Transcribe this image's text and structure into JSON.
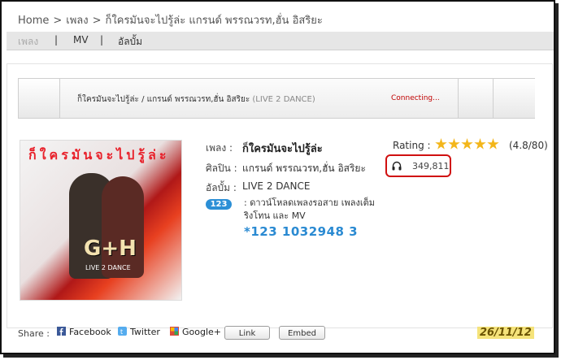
{
  "breadcrumb": {
    "home": "Home",
    "sep1": ">",
    "section": "เพลง",
    "sep2": ">",
    "current": "ก็ใครมันจะไปรู้ล่ะ แกรนด์ พรรณวรท,ฮั่น อิสริยะ"
  },
  "tabs": {
    "songs": "เพลง",
    "sep1": "|",
    "mv": "MV",
    "sep2": "|",
    "albums": "อัลบั้ม"
  },
  "player": {
    "track_title": "ก็ใครมันจะไปรู้ล่ะ",
    "track_sep": " / ",
    "track_artist": "แกรนด์ พรรณวรท,ฮั่น อิสริยะ",
    "track_album": " (LIVE 2 DANCE)",
    "status": "Connecting..."
  },
  "cover": {
    "title_art": "ก็ใครมันจะไปรู้ล่ะ",
    "album_art": "G+H",
    "album_sub": "LIVE 2 DANCE"
  },
  "info": {
    "song_label": "เพลง :",
    "song_value": "ก็ใครมันจะไปรู้ล่ะ",
    "artist_label": "ศิลปิน :",
    "artist_value": "แกรนด์ พรรณวรท,ฮั่น อิสริยะ",
    "album_label": "อัลบั้ม :",
    "album_value": "LIVE 2 DANCE",
    "badge": "123",
    "promo_text": ": ดาวน์โหลดเพลงรอสาย เพลงเต็ม ริงโทน และ MV",
    "code": "*123 1032948 3"
  },
  "rating": {
    "label": "Rating :",
    "stars": 5,
    "value": "(4.8/80)"
  },
  "plays": {
    "icon": "headphones-icon",
    "count": "349,811",
    "highlight_color": "#d01010"
  },
  "share": {
    "label": "Share :",
    "facebook": "Facebook",
    "twitter": "Twitter",
    "googleplus": "Google+",
    "link_button": "Link",
    "embed_button": "Embed"
  },
  "date": "26/11/12",
  "colors": {
    "accent_blue": "#2a8ad2",
    "status_red": "#c00000",
    "star": "#f3b61a"
  }
}
